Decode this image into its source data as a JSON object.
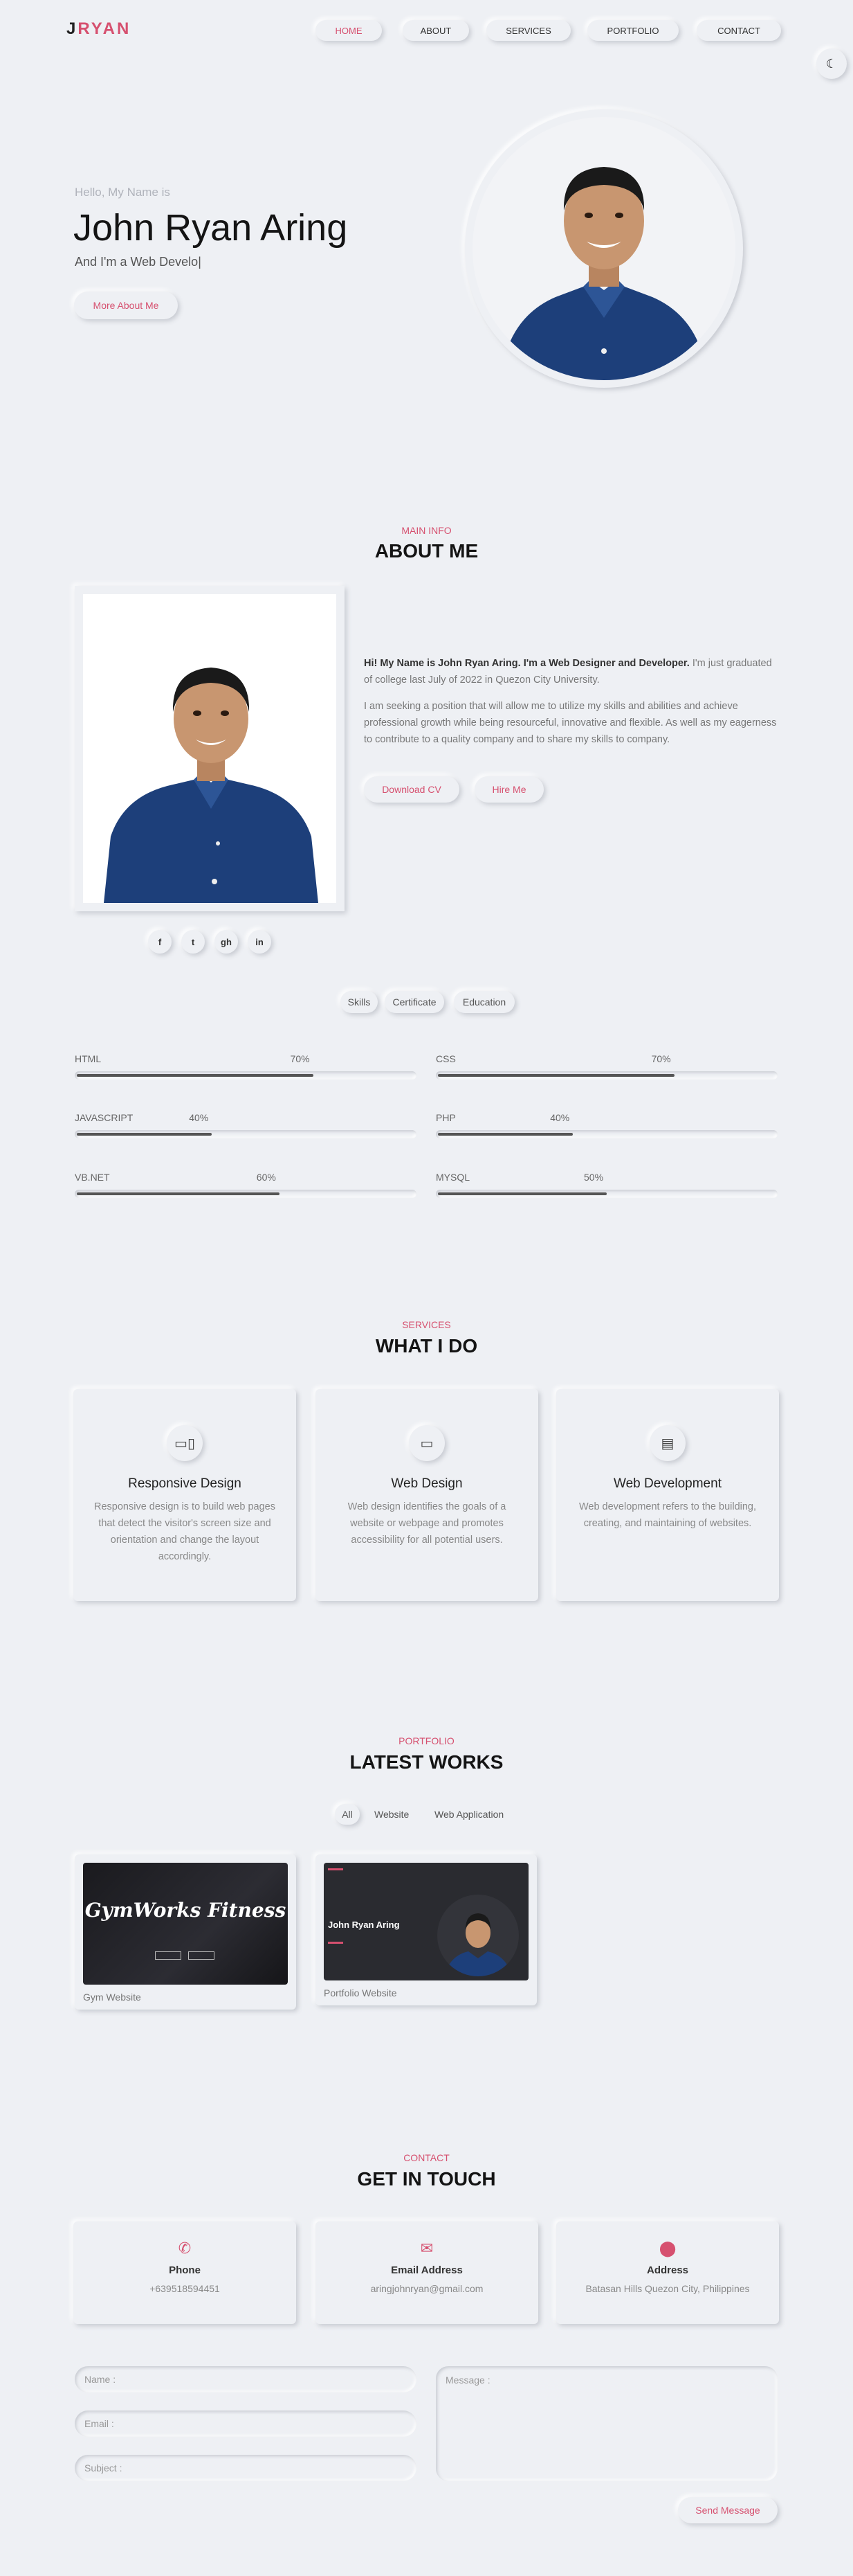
{
  "header": {
    "logo_first": "J",
    "logo_rest": "RYAN",
    "nav": [
      "HOME",
      "ABOUT",
      "SERVICES",
      "PORTFOLIO",
      "CONTACT"
    ],
    "theme_icon": "moon-icon"
  },
  "hero": {
    "hello": "Hello, My Name is",
    "name": "John Ryan Aring",
    "tagline": "And I'm a Web Develo|",
    "button": "More About Me"
  },
  "about": {
    "sub": "MAIN INFO",
    "title": "ABOUT ME",
    "intro_bold": "Hi! My Name is John Ryan Aring. I'm a Web Designer and Developer.",
    "intro_rest": " I'm just graduated of college last July of 2022 in Quezon City University.",
    "paragraph2": "I am seeking a position that will allow me to utilize my skills and abilities and achieve professional growth while being resourceful, innovative and flexible. As well as my eagerness to contribute to a quality company and to share my skills to company.",
    "download_button": "Download CV",
    "hire_button": "Hire Me",
    "social": [
      "f",
      "t",
      "gh",
      "in"
    ],
    "tabs": [
      "Skills",
      "Certificate",
      "Education"
    ]
  },
  "skills": [
    {
      "name": "HTML",
      "percent": "70%",
      "value": 70
    },
    {
      "name": "CSS",
      "percent": "70%",
      "value": 70
    },
    {
      "name": "JAVASCRIPT",
      "percent": "40%",
      "value": 40
    },
    {
      "name": "PHP",
      "percent": "40%",
      "value": 40
    },
    {
      "name": "VB.NET",
      "percent": "60%",
      "value": 60
    },
    {
      "name": "MYSQL",
      "percent": "50%",
      "value": 50
    }
  ],
  "services": {
    "sub": "SERVICES",
    "title": "WHAT I DO",
    "items": [
      {
        "icon": "devices-icon",
        "title": "Responsive Design",
        "text": "Responsive design is to build web pages that detect the visitor's screen size and orientation and change the layout accordingly."
      },
      {
        "icon": "monitor-icon",
        "title": "Web Design",
        "text": "Web design identifies the goals of a website or webpage and promotes accessibility for all potential users."
      },
      {
        "icon": "code-device-icon",
        "title": "Web Development",
        "text": "Web development refers to the building, creating, and maintaining of websites."
      }
    ]
  },
  "portfolio": {
    "sub": "PORTFOLIO",
    "title": "LATEST WORKS",
    "filters": [
      "All",
      "Website",
      "Web Application"
    ],
    "works": [
      {
        "label": "Gym Website",
        "thumb_title": "GymWorks Fitness"
      },
      {
        "label": "Portfolio Website",
        "thumb_title": "John Ryan Aring"
      }
    ]
  },
  "contact": {
    "sub": "CONTACT",
    "title": "GET IN TOUCH",
    "cards": [
      {
        "icon": "phone-icon",
        "title": "Phone",
        "value": "+639518594451"
      },
      {
        "icon": "envelope-icon",
        "title": "Email Address",
        "value": "aringjohnryan@gmail.com"
      },
      {
        "icon": "location-pin-icon",
        "title": "Address",
        "value": "Batasan Hills Quezon City, Philippines"
      }
    ],
    "name_placeholder": "Name :",
    "email_placeholder": "Email :",
    "subject_placeholder": "Subject :",
    "message_placeholder": "Message :",
    "send_button": "Send Message"
  },
  "colors": {
    "accent": "#d6506f",
    "background": "#eef0f4",
    "shirt": "#1d3f7a"
  }
}
